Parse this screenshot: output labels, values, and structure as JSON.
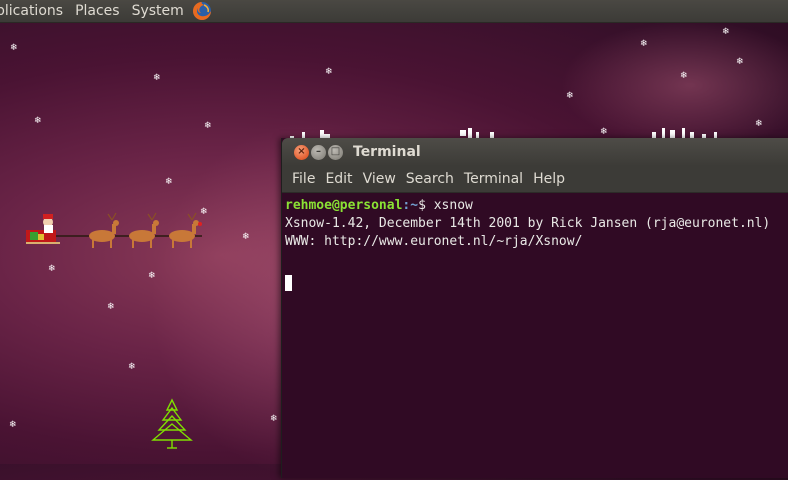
{
  "top_panel": {
    "menu": [
      "plications",
      "Places",
      "System"
    ],
    "browser_icon": "firefox-icon"
  },
  "desktop": {
    "sleigh_icon": "santa-sleigh-icon",
    "tree_icon": "christmas-tree-icon",
    "snow_icon": "snowflake-icon"
  },
  "terminal": {
    "title": "Terminal",
    "buttons": {
      "close": "×",
      "minimize": "–",
      "maximize": "□"
    },
    "menu": [
      "File",
      "Edit",
      "View",
      "Search",
      "Terminal",
      "Help"
    ],
    "prompt": {
      "user": "rehmoe@personal",
      "path": ":~",
      "symbol": "$ ",
      "command": "xsnow"
    },
    "output": [
      "Xsnow-1.42, December 14th 2001 by Rick Jansen (rja@euronet.nl)",
      "WWW: http://www.euronet.nl/~rja/Xsnow/"
    ]
  },
  "colors": {
    "background": "#4a1333",
    "terminal_bg": "#300a24",
    "prompt_user": "#8ae234",
    "prompt_path": "#729fcf",
    "panel": "#3c3b37"
  }
}
